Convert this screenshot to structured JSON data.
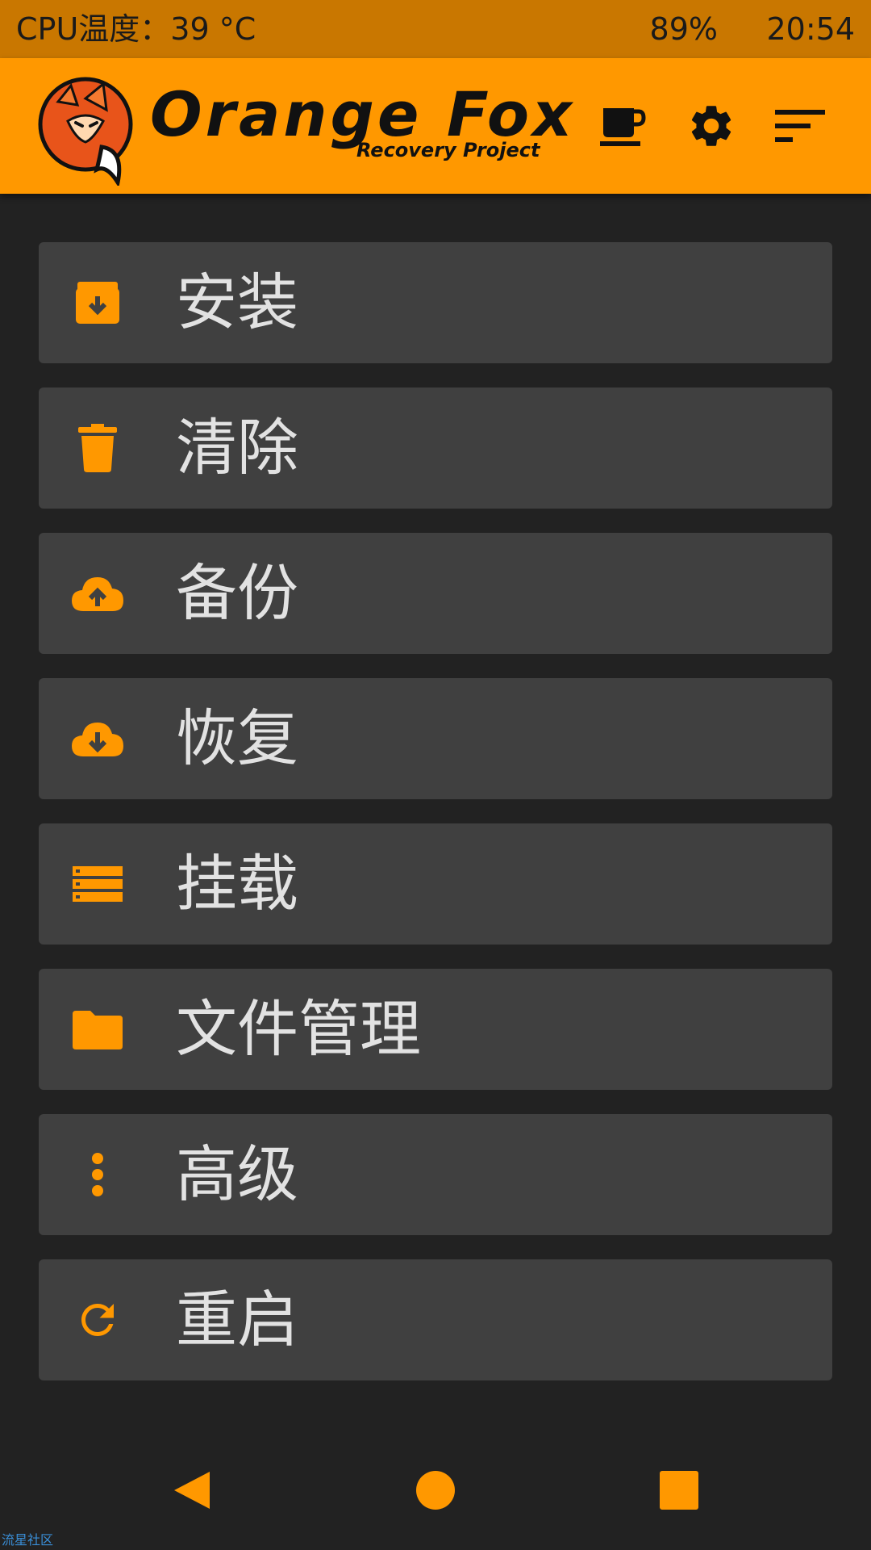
{
  "status_bar": {
    "cpu_temp": "CPU温度：39 °C",
    "battery": "89%",
    "time": "20:54"
  },
  "header": {
    "brand_title": "Orange Fox",
    "brand_subtitle": "Recovery Project",
    "icons": [
      "coffee-icon",
      "gear-icon",
      "sort-menu-icon"
    ]
  },
  "menu": {
    "items": [
      {
        "label": "安装",
        "icon": "archive-download-icon"
      },
      {
        "label": "清除",
        "icon": "trash-icon"
      },
      {
        "label": "备份",
        "icon": "cloud-upload-icon"
      },
      {
        "label": "恢复",
        "icon": "cloud-download-icon"
      },
      {
        "label": "挂载",
        "icon": "storage-icon"
      },
      {
        "label": "文件管理",
        "icon": "folder-icon"
      },
      {
        "label": "高级",
        "icon": "more-vertical-icon"
      },
      {
        "label": "重启",
        "icon": "refresh-icon"
      }
    ]
  },
  "navbar": {
    "icons": [
      "back-icon",
      "home-icon",
      "recents-icon"
    ]
  },
  "watermark": "流星社区",
  "colors": {
    "accent": "#FF9800",
    "status_bar": "#C97700",
    "background": "#222222",
    "item_background": "#404040",
    "label_text": "#E2E2E2"
  }
}
